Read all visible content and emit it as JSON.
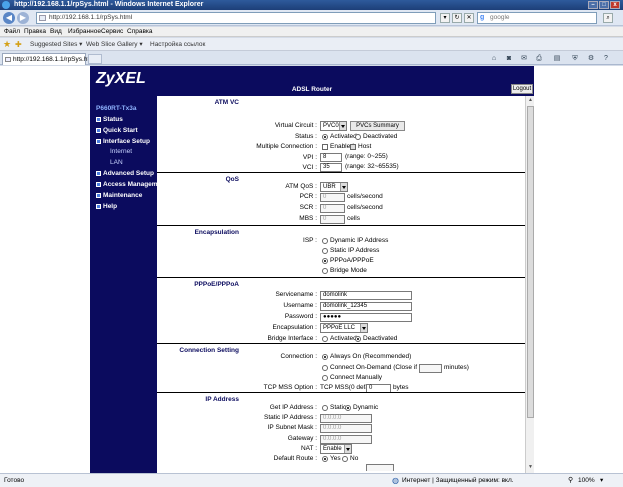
{
  "window": {
    "title": "http://192.168.1.1/rpSys.html - Windows Internet Explorer"
  },
  "address_bar": {
    "url": "http://192.168.1.1/rpSys.html",
    "search_placeholder": "google"
  },
  "menu": [
    "Файл",
    "Правка",
    "Вид",
    "Избранное",
    "Сервис",
    "Справка"
  ],
  "favorites_bar": {
    "items": [
      "Suggested Sites ▾",
      "Web Slice Gallery ▾",
      "Настройка ссылок"
    ]
  },
  "tab": {
    "label": "http://192.168.1.1/rpSys.html"
  },
  "router": {
    "brand": "ZyXEL",
    "product": "ADSL Router",
    "logout_label": "Logout",
    "model": "P660RT-Tx3a",
    "nav": [
      {
        "label": "Status"
      },
      {
        "label": "Quick Start"
      },
      {
        "label": "Interface Setup"
      },
      {
        "label": "Internet",
        "sub": true
      },
      {
        "label": "LAN",
        "sub": true
      },
      {
        "label": "Advanced Setup"
      },
      {
        "label": "Access Manageme"
      },
      {
        "label": "Maintenance"
      },
      {
        "label": "Help"
      }
    ]
  },
  "form": {
    "atm_vc": {
      "heading": "ATM VC",
      "virtual_circuit_label": "Virtual Circuit :",
      "virtual_circuit_value": "PVC0",
      "pvcs_summary_label": "PVCs Summary",
      "status_label": "Status :",
      "status_activated": "Activated",
      "status_deactivated": "Deactivated",
      "multiple_connection_label": "Multiple Connection :",
      "enabled_label": "Enabled",
      "host_label": "Host",
      "vpi_label": "VPI :",
      "vpi_value": "8",
      "vpi_range": "(range: 0~255)",
      "vci_label": "VCI :",
      "vci_value": "35",
      "vci_range": "(range: 32~65535)"
    },
    "qos": {
      "heading": "QoS",
      "atm_qos_label": "ATM QoS :",
      "atm_qos_value": "UBR",
      "pcr_label": "PCR :",
      "pcr_value": "0",
      "pcr_unit": "cells/second",
      "scr_label": "SCR :",
      "scr_value": "0",
      "scr_unit": "cells/second",
      "mbs_label": "MBS :",
      "mbs_value": "0",
      "mbs_unit": "cells"
    },
    "encapsulation": {
      "heading": "Encapsulation",
      "isp_label": "ISP :",
      "options": [
        "Dynamic IP Address",
        "Static IP Address",
        "PPPoA/PPPoE",
        "Bridge Mode"
      ],
      "selected": 2
    },
    "pppoe": {
      "heading": "PPPoE/PPPoA",
      "servicename_label": "Servicename :",
      "servicename_value": "domolink",
      "username_label": "Username :",
      "username_value": "domolink_12345",
      "password_label": "Password :",
      "password_value": "●●●●●",
      "encapsulation_label": "Encapsulation :",
      "encapsulation_value": "PPPoE LLC",
      "bridge_interface_label": "Bridge Interface :",
      "bridge_activated": "Activated",
      "bridge_deactivated": "Deactivated"
    },
    "connection_setting": {
      "heading": "Connection Setting",
      "connection_label": "Connection :",
      "always_on": "Always On (Recommended)",
      "on_demand_prefix": "Connect On-Demand (Close if idle for",
      "on_demand_suffix": "minutes)",
      "manually": "Connect Manually",
      "tcp_mss_label": "TCP MSS Option :",
      "tcp_mss_prefix": "TCP MSS(0 default)",
      "tcp_mss_value": "0",
      "tcp_mss_unit": "bytes"
    },
    "ip_address": {
      "heading": "IP Address",
      "get_ip_label": "Get IP Address :",
      "static_label": "Static",
      "dynamic_label": "Dynamic",
      "static_ip_label": "Static IP Address :",
      "static_ip_value": "0.0.0.0",
      "subnet_label": "IP Subnet Mask :",
      "subnet_value": "0.0.0.0",
      "gateway_label": "Gateway :",
      "gateway_value": "0.0.0.0",
      "nat_label": "NAT :",
      "nat_value": "Enable",
      "default_route_label": "Default Route :",
      "yes_label": "Yes",
      "no_label": "No"
    }
  },
  "statusbar": {
    "left": "Готово",
    "zone": "Интернет | Защищенный режим: вкл.",
    "zoom": "100%"
  }
}
